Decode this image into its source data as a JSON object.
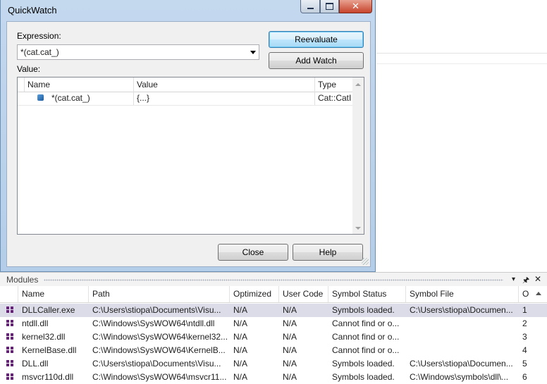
{
  "quickwatch": {
    "title": "QuickWatch",
    "expression_label": "Expression:",
    "expression_value": "*(cat.cat_)",
    "value_label": "Value:",
    "buttons": {
      "reevaluate": "Reevaluate",
      "add_watch": "Add Watch",
      "close": "Close",
      "help": "Help"
    },
    "columns": {
      "name": "Name",
      "value": "Value",
      "type": "Type"
    },
    "rows": [
      {
        "name": "*(cat.cat_)",
        "value": "{...}",
        "type": "Cat::CatI"
      }
    ]
  },
  "window_controls": {
    "minimize": "–",
    "close": "✕"
  },
  "modules": {
    "title": "Modules",
    "toolbar": {
      "dropdown": "▾",
      "pin": "🖈",
      "close": "✕"
    },
    "columns": {
      "name": "Name",
      "path": "Path",
      "optimized": "Optimized",
      "user_code": "User Code",
      "symbol_status": "Symbol Status",
      "symbol_file": "Symbol File",
      "order": "O"
    },
    "rows": [
      {
        "name": "DLLCaller.exe",
        "path": "C:\\Users\\stiopa\\Documents\\Visu...",
        "optimized": "N/A",
        "user_code": "N/A",
        "symbol_status": "Symbols loaded.",
        "symbol_file": "C:\\Users\\stiopa\\Documen...",
        "order": "1"
      },
      {
        "name": "ntdll.dll",
        "path": "C:\\Windows\\SysWOW64\\ntdll.dll",
        "optimized": "N/A",
        "user_code": "N/A",
        "symbol_status": "Cannot find or o...",
        "symbol_file": "",
        "order": "2"
      },
      {
        "name": "kernel32.dll",
        "path": "C:\\Windows\\SysWOW64\\kernel32...",
        "optimized": "N/A",
        "user_code": "N/A",
        "symbol_status": "Cannot find or o...",
        "symbol_file": "",
        "order": "3"
      },
      {
        "name": "KernelBase.dll",
        "path": "C:\\Windows\\SysWOW64\\KernelB...",
        "optimized": "N/A",
        "user_code": "N/A",
        "symbol_status": "Cannot find or o...",
        "symbol_file": "",
        "order": "4"
      },
      {
        "name": "DLL.dll",
        "path": "C:\\Users\\stiopa\\Documents\\Visu...",
        "optimized": "N/A",
        "user_code": "N/A",
        "symbol_status": "Symbols loaded.",
        "symbol_file": "C:\\Users\\stiopa\\Documen...",
        "order": "5"
      },
      {
        "name": "msvcr110d.dll",
        "path": "C:\\Windows\\SysWOW64\\msvcr11...",
        "optimized": "N/A",
        "user_code": "N/A",
        "symbol_status": "Symbols loaded.",
        "symbol_file": "C:\\Windows\\symbols\\dll\\...",
        "order": "6"
      }
    ]
  },
  "colors": {
    "selected_row": "#dcdce8",
    "module_icon": "#68217a",
    "window_frame": "#b9d1ea"
  }
}
